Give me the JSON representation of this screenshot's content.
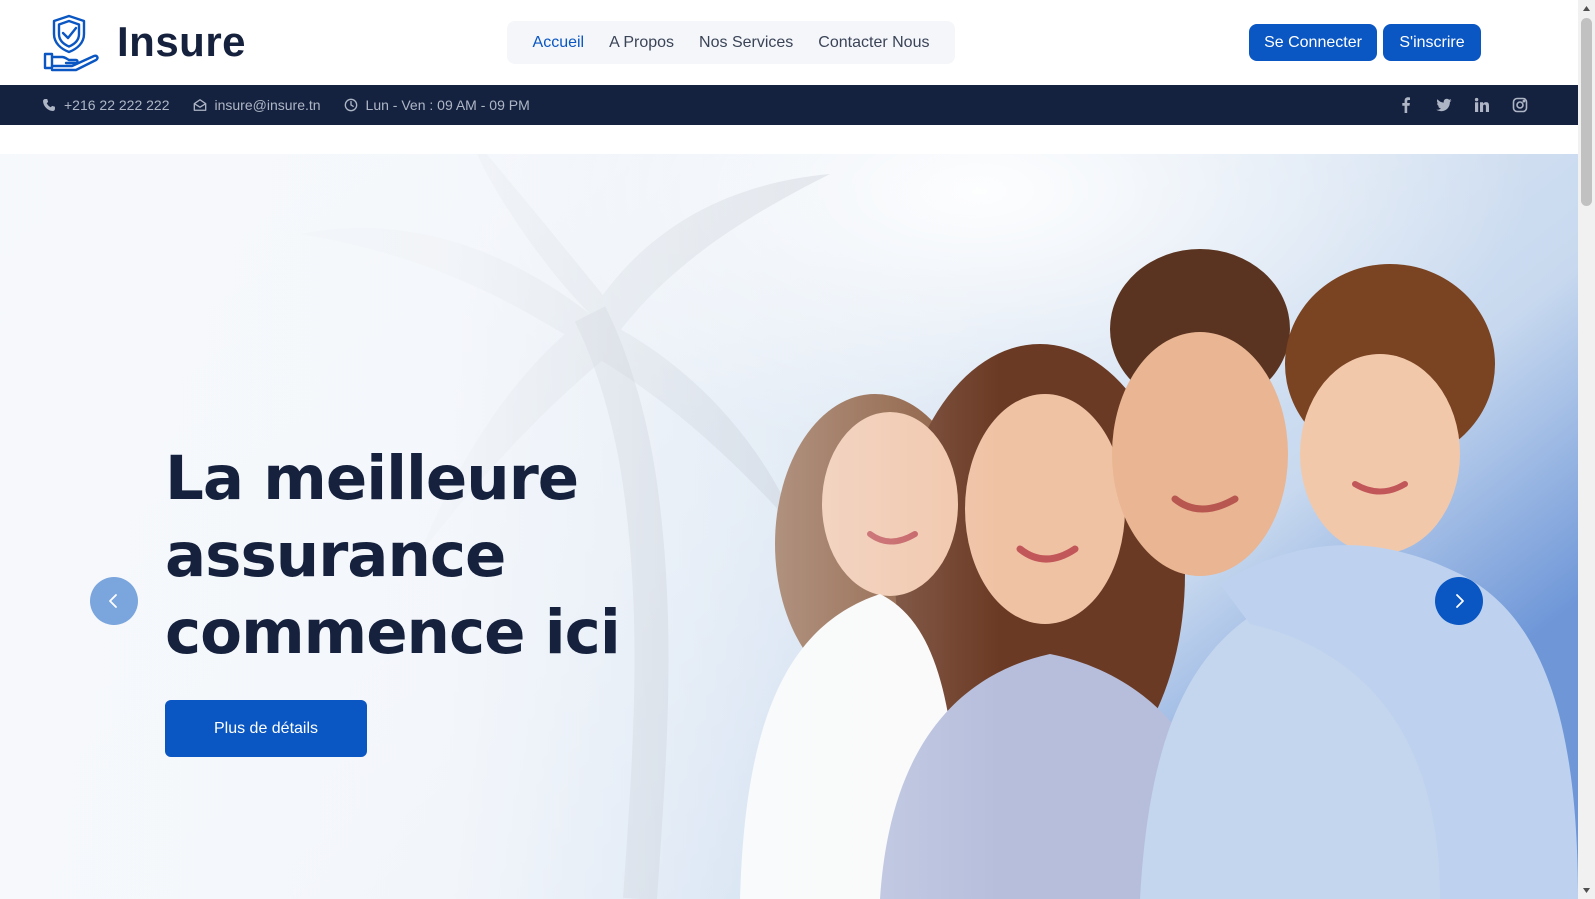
{
  "header": {
    "logo_text": "Insure",
    "nav": [
      {
        "label": "Accueil",
        "active": true
      },
      {
        "label": "A Propos",
        "active": false
      },
      {
        "label": "Nos Services",
        "active": false
      },
      {
        "label": "Contacter Nous",
        "active": false
      }
    ],
    "login_label": "Se Connecter",
    "signup_label": "S'inscrire"
  },
  "topbar": {
    "phone": "+216 22 222 222",
    "email": "insure@insure.tn",
    "hours": "Lun - Ven : 09 AM - 09 PM",
    "socials": [
      "facebook-icon",
      "twitter-icon",
      "linkedin-icon",
      "instagram-icon"
    ]
  },
  "hero": {
    "title": "La meilleure assurance commence ici",
    "cta_label": "Plus de détails"
  },
  "colors": {
    "accent": "#0a56c2",
    "dark": "#15213d",
    "topbar": "#15223f"
  }
}
